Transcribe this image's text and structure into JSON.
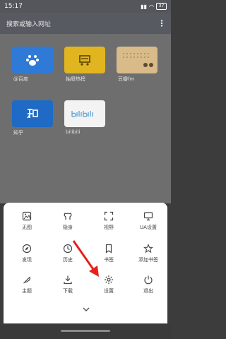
{
  "status": {
    "time": "15:17",
    "battery": "37"
  },
  "search": {
    "placeholder": "搜索或输入网址"
  },
  "shortcuts": [
    {
      "label": "@百度",
      "icon": "baidu-paw-icon",
      "color": "#2f7ad6"
    },
    {
      "label": "抽屉热榜",
      "icon": "drawer-cart-icon",
      "color": "#e0b51f"
    },
    {
      "label": "豆瓣fm",
      "icon": "radio-icon",
      "color": "#d9bb8a"
    },
    {
      "label": "知乎",
      "icon": "zhihu-icon",
      "color": "#1f6ac5"
    },
    {
      "label": "bilibili",
      "icon": "bilibili-logo",
      "color": "#f3f3f3"
    }
  ],
  "menu": [
    {
      "label": "无图",
      "icon": "image-icon"
    },
    {
      "label": "隐身",
      "icon": "incognito-icon"
    },
    {
      "label": "视野",
      "icon": "fullscreen-icon"
    },
    {
      "label": "UA设置",
      "icon": "monitor-icon"
    },
    {
      "label": "发现",
      "icon": "compass-icon"
    },
    {
      "label": "历史",
      "icon": "clock-icon"
    },
    {
      "label": "书签",
      "icon": "bookmark-icon"
    },
    {
      "label": "添加书签",
      "icon": "star-icon"
    },
    {
      "label": "主题",
      "icon": "feather-icon"
    },
    {
      "label": "下载",
      "icon": "download-icon"
    },
    {
      "label": "设置",
      "icon": "gear-icon"
    },
    {
      "label": "退出",
      "icon": "power-icon"
    }
  ],
  "annotation": {
    "arrow_color": "#e6201a"
  }
}
